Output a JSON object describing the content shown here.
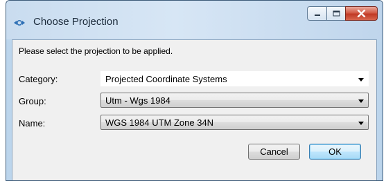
{
  "window": {
    "title": "Choose Projection",
    "app_icon": "projection-icon"
  },
  "caption_buttons": {
    "minimize_icon": "minimize-icon",
    "maximize_icon": "maximize-icon",
    "close_icon": "close-icon"
  },
  "dialog": {
    "prompt": "Please select the projection to be applied.",
    "fields": [
      {
        "label": "Category:",
        "value": "Projected Coordinate Systems"
      },
      {
        "label": "Group:",
        "value": "Utm - Wgs 1984"
      },
      {
        "label": "Name:",
        "value": "WGS 1984 UTM Zone 34N"
      }
    ],
    "cancel_label": "Cancel",
    "ok_label": "OK"
  }
}
